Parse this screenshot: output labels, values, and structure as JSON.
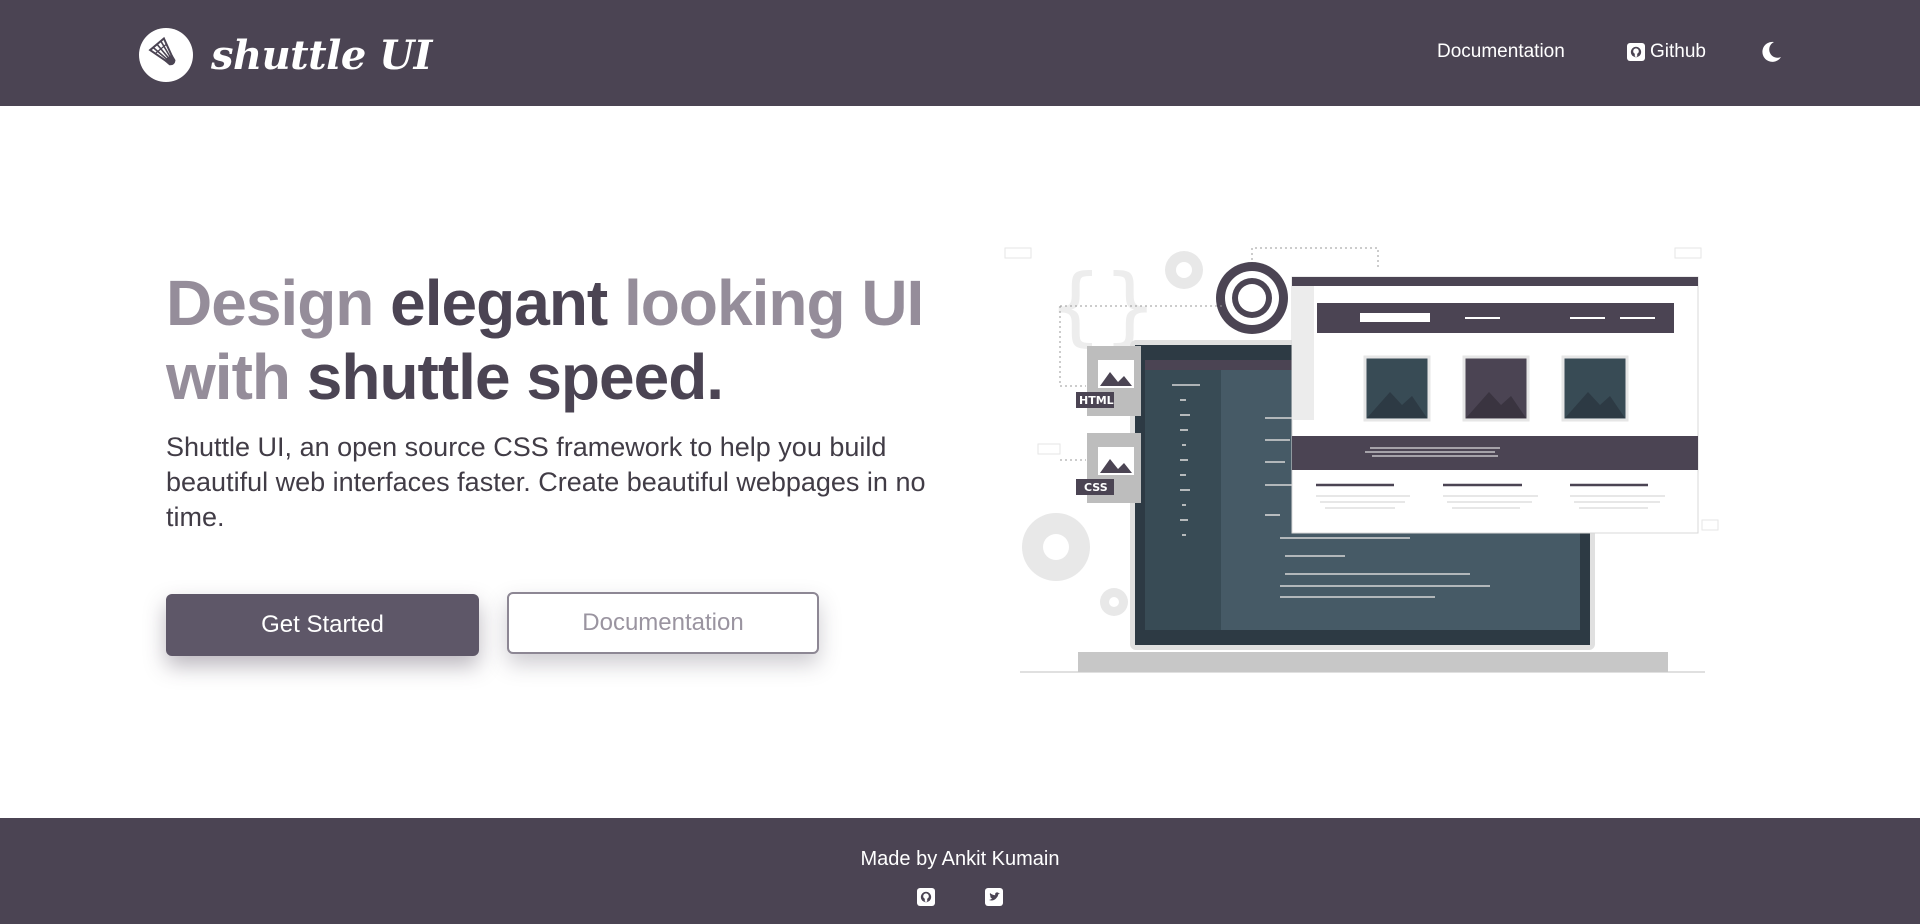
{
  "brand": {
    "name": "shuttle UI",
    "icon": "shuttlecock-icon"
  },
  "nav": {
    "documentation_label": "Documentation",
    "github_label": "Github",
    "theme_icon": "moon-icon"
  },
  "hero": {
    "title": {
      "w1": "Design ",
      "w2": "elegant ",
      "w3": "looking UI",
      "w4": "with ",
      "w5": "shuttle speed."
    },
    "description": "Shuttle UI, an open source CSS framework to help you build beautiful web interfaces faster. Create beautiful webpages in no time.",
    "primary_button": "Get Started",
    "secondary_button": "Documentation"
  },
  "illustration": {
    "html_badge": "HTML",
    "css_badge": "CSS"
  },
  "footer": {
    "text": "Made by Ankit Kumain",
    "icons": [
      "github-icon",
      "twitter-icon"
    ]
  },
  "colors": {
    "nav_bg": "#4b4453",
    "title_strong": "#4b4453",
    "title_muted": "#958d9a",
    "primary_button": "#5e5768"
  }
}
